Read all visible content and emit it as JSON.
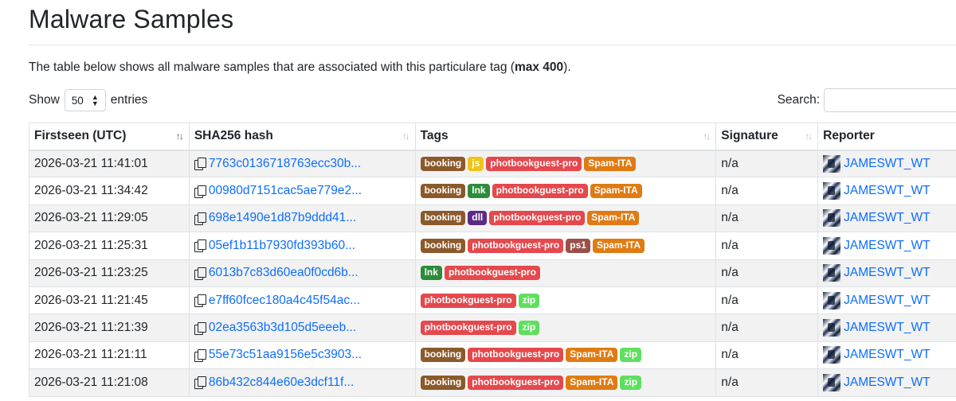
{
  "page": {
    "title": "Malware Samples",
    "intro_prefix": "The table below shows all malware samples that are associated with this particulare tag (",
    "intro_bold": "max 400",
    "intro_suffix": ")."
  },
  "controls": {
    "show_label": "Show",
    "entries_value": "50",
    "entries_label": "entries",
    "search_label": "Search:",
    "search_value": ""
  },
  "table": {
    "columns": [
      "Firstseen (UTC)",
      "SHA256 hash",
      "Tags",
      "Signature",
      "Reporter"
    ],
    "rows": [
      {
        "firstseen": "2026-03-21 11:41:01",
        "hash": "7763c0136718763ecc30b...",
        "tags": [
          "booking",
          "js",
          "photbookguest-pro",
          "Spam-ITA"
        ],
        "signature": "n/a",
        "reporter": "JAMESWT_WT"
      },
      {
        "firstseen": "2026-03-21 11:34:42",
        "hash": "00980d7151cac5ae779e2...",
        "tags": [
          "booking",
          "lnk",
          "photbookguest-pro",
          "Spam-ITA"
        ],
        "signature": "n/a",
        "reporter": "JAMESWT_WT"
      },
      {
        "firstseen": "2026-03-21 11:29:05",
        "hash": "698e1490e1d87b9ddd41...",
        "tags": [
          "booking",
          "dll",
          "photbookguest-pro",
          "Spam-ITA"
        ],
        "signature": "n/a",
        "reporter": "JAMESWT_WT"
      },
      {
        "firstseen": "2026-03-21 11:25:31",
        "hash": "05ef1b11b7930fd393b60...",
        "tags": [
          "booking",
          "photbookguest-pro",
          "ps1",
          "Spam-ITA"
        ],
        "signature": "n/a",
        "reporter": "JAMESWT_WT"
      },
      {
        "firstseen": "2026-03-21 11:23:25",
        "hash": "6013b7c83d60ea0f0cd6b...",
        "tags": [
          "lnk",
          "photbookguest-pro"
        ],
        "signature": "n/a",
        "reporter": "JAMESWT_WT"
      },
      {
        "firstseen": "2026-03-21 11:21:45",
        "hash": "e7ff60fcec180a4c45f54ac...",
        "tags": [
          "photbookguest-pro",
          "zip"
        ],
        "signature": "n/a",
        "reporter": "JAMESWT_WT"
      },
      {
        "firstseen": "2026-03-21 11:21:39",
        "hash": "02ea3563b3d105d5eeeb...",
        "tags": [
          "photbookguest-pro",
          "zip"
        ],
        "signature": "n/a",
        "reporter": "JAMESWT_WT"
      },
      {
        "firstseen": "2026-03-21 11:21:11",
        "hash": "55e73c51aa9156e5c3903...",
        "tags": [
          "booking",
          "photbookguest-pro",
          "Spam-ITA",
          "zip"
        ],
        "signature": "n/a",
        "reporter": "JAMESWT_WT"
      },
      {
        "firstseen": "2026-03-21 11:21:08",
        "hash": "86b432c844e60e3dcf11f...",
        "tags": [
          "booking",
          "photbookguest-pro",
          "Spam-ITA",
          "zip"
        ],
        "signature": "n/a",
        "reporter": "JAMESWT_WT"
      }
    ]
  },
  "tag_colors": {
    "booking": "#8b5a2b",
    "js": "#f0c419",
    "lnk": "#2e8b3a",
    "dll": "#5b2a86",
    "ps1": "#9a5148",
    "photbookguest-pro": "#e5484d",
    "Spam-ITA": "#e07b14",
    "zip": "#5ee05e"
  },
  "tag_text_colors": {
    "js": "#ffffff"
  }
}
